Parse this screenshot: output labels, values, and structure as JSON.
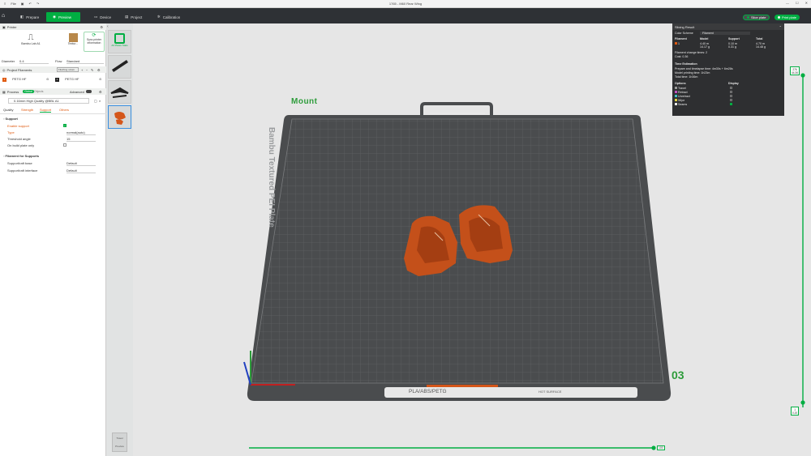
{
  "window": {
    "title": "1765 - M60 Rear Wing",
    "menu_label": "File"
  },
  "topnav": {
    "tabs": [
      {
        "label": "Prepare",
        "active": false
      },
      {
        "label": "Preview",
        "active": true
      },
      {
        "label": "Device",
        "active": false
      },
      {
        "label": "Project",
        "active": false
      },
      {
        "label": "Calibration",
        "active": false
      }
    ],
    "slice_label": "Slice plate",
    "print_label": "Print plate",
    "accent": "#00ae42"
  },
  "printer": {
    "section_title": "Printer",
    "printer_name": "Bambu Lab A1",
    "plate_name": "Textur...",
    "sync_label": "Sync printer information",
    "diameter_label": "Diameter",
    "diameter_value": "0.4",
    "flow_label": "Flow",
    "flow_value": "Standard"
  },
  "filaments": {
    "section_title": "Project Filaments",
    "flushing_label": "Flushing volum...",
    "items": [
      {
        "index": "1",
        "name": "PETG HF",
        "color": "#e05a10"
      },
      {
        "index": "2",
        "name": "PETG HF",
        "color": "#222222"
      }
    ]
  },
  "process": {
    "section_title": "Process",
    "toggle_global": "Global",
    "toggle_objects": "Objects",
    "advanced_label": "Advanced",
    "preset": "0.16mm High Quality @BBL A1",
    "tabs": [
      "Quality",
      "Strength",
      "Support",
      "Others"
    ],
    "active_tab": "Support",
    "support_group": "Support",
    "fields": [
      {
        "label": "Enable support",
        "value": "",
        "type": "checkbox",
        "checked": true
      },
      {
        "label": "Type",
        "value": "normal(auto)",
        "type": "select"
      },
      {
        "label": "Threshold angle",
        "value": "15",
        "type": "number"
      },
      {
        "label": "On build plate only",
        "value": "",
        "type": "checkbox",
        "checked": false
      }
    ],
    "filament_group": "Filament for Supports",
    "filament_fields": [
      {
        "label": "Support/raft base",
        "value": "Default"
      },
      {
        "label": "Support/raft interface",
        "value": "Default"
      }
    ]
  },
  "thumbnails": {
    "first_label": "All Plates Stats"
  },
  "plate": {
    "title": "Mount",
    "number": "03",
    "bed_text": "Bambu Textured PEI Plate",
    "bed_footer": "PLA/ABS/PETG",
    "surface_label": "HOT SURFACE"
  },
  "slicing": {
    "title": "Slicing Result",
    "color_scheme_label": "Color Scheme",
    "color_scheme_value": "Filament",
    "headers": [
      "Filament",
      "Model",
      "Support",
      "Total"
    ],
    "rows": [
      {
        "id": "1",
        "model": "4.40 m\n14.17 g",
        "support": "0.10 m\n0.31 g",
        "total": "4.70 m\n14.48 g"
      }
    ],
    "change_times": "Filament change times: 2",
    "cost": "Cost: 0.36",
    "time_title": "Time Estimation",
    "prepare_time": "Prepare and timelapse time: 4m30s + 6m28s",
    "model_time": "Model printing time: 1h23m",
    "total_time": "Total time: 1h36m",
    "options_label": "Options",
    "display_label": "Display",
    "options": [
      {
        "name": "Travel",
        "color": "#999999",
        "on": false
      },
      {
        "name": "Retract",
        "color": "#c050c0",
        "on": false
      },
      {
        "name": "Unretract",
        "color": "#40c0c0",
        "on": false
      },
      {
        "name": "Wipe",
        "color": "#e0d040",
        "on": false
      },
      {
        "name": "Seams",
        "color": "#e8e8e8",
        "on": true
      }
    ]
  },
  "layers": {
    "top_value": "276",
    "top_height": "44.36",
    "bottom_value": "1",
    "bottom_height": "0.20",
    "progress_value": "100",
    "progress_fraction": 1.0
  },
  "legend": {
    "line1": "Travel",
    "line2": "Preview"
  }
}
